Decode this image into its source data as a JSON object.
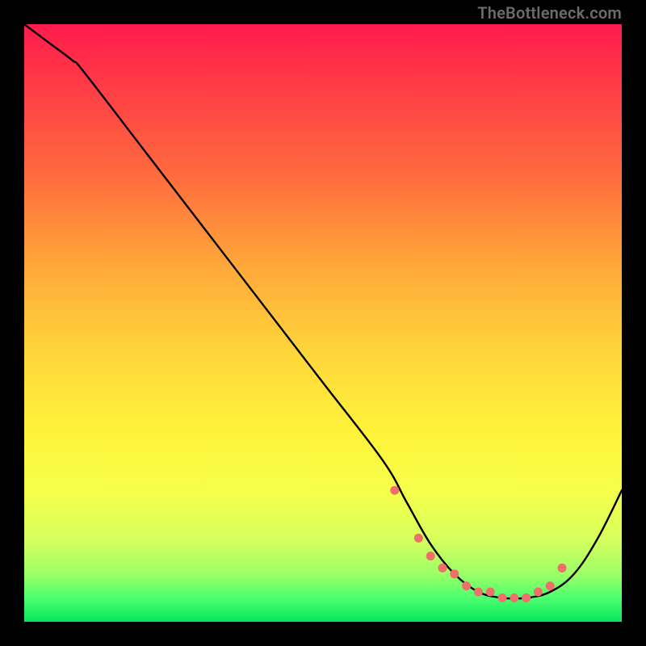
{
  "watermark": "TheBottleneck.com",
  "chart_data": {
    "type": "line",
    "title": "",
    "xlabel": "",
    "ylabel": "",
    "xlim": [
      0,
      100
    ],
    "ylim": [
      0,
      100
    ],
    "series": [
      {
        "name": "bottleneck-curve",
        "x": [
          0,
          4,
          8,
          10,
          20,
          30,
          40,
          50,
          60,
          64,
          68,
          72,
          76,
          80,
          84,
          88,
          92,
          96,
          100
        ],
        "y": [
          100,
          97,
          94,
          92,
          79,
          66,
          53,
          40,
          27,
          20,
          13,
          8,
          5,
          4,
          4,
          5,
          8,
          14,
          22
        ]
      }
    ],
    "markers": {
      "name": "highlight-dots",
      "color": "#ef6f6a",
      "x": [
        62,
        66,
        68,
        70,
        72,
        74,
        76,
        78,
        80,
        82,
        84,
        86,
        88,
        90
      ],
      "y": [
        22,
        14,
        11,
        9,
        8,
        6,
        5,
        5,
        4,
        4,
        4,
        5,
        6,
        9
      ]
    }
  }
}
